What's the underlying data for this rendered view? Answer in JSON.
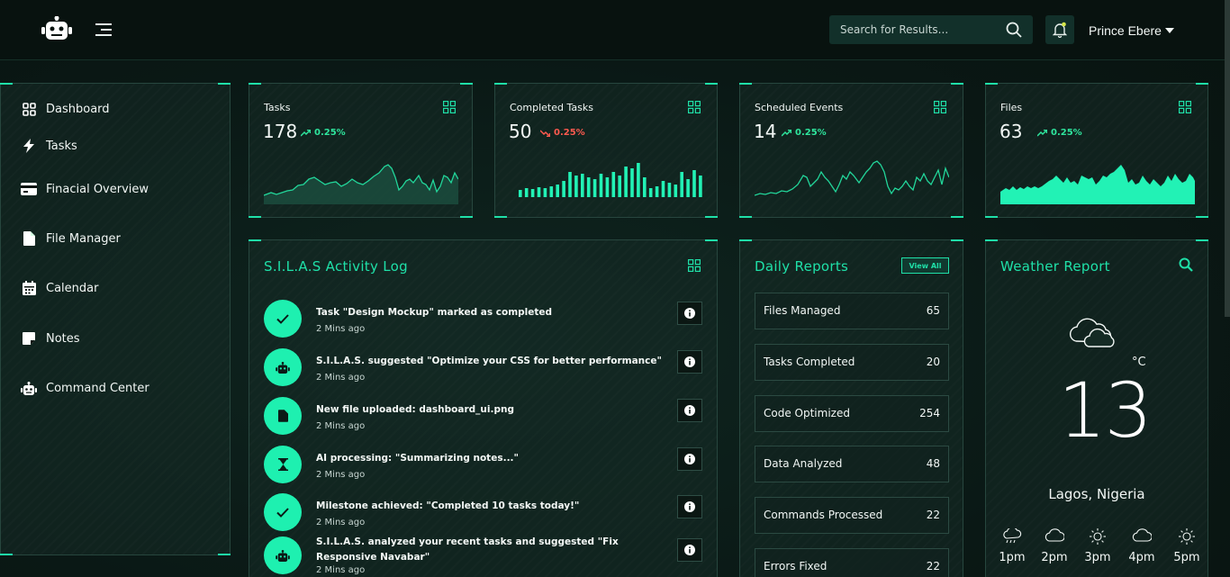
{
  "header": {
    "search_placeholder": "Search for Results...",
    "user_name": "Prince Ebere"
  },
  "sidebar": {
    "items": [
      {
        "label": "Dashboard",
        "icon": "grid-icon"
      },
      {
        "label": "Tasks",
        "icon": "bolt-icon"
      },
      {
        "label": "Finacial Overview",
        "icon": "credit-card-icon"
      },
      {
        "label": "File Manager",
        "icon": "file-icon"
      },
      {
        "label": "Calendar",
        "icon": "calendar-icon"
      },
      {
        "label": "Notes",
        "icon": "note-icon"
      },
      {
        "label": "Command Center",
        "icon": "robot-icon"
      }
    ]
  },
  "stats": [
    {
      "title": "Tasks",
      "value": "178",
      "change": "0.25%",
      "trend": "up",
      "chart": "area"
    },
    {
      "title": "Completed Tasks",
      "value": "50",
      "change": "0.25%",
      "trend": "down",
      "chart": "bar"
    },
    {
      "title": "Scheduled Events",
      "value": "14",
      "change": "0.25%",
      "trend": "up",
      "chart": "line"
    },
    {
      "title": "Files",
      "value": "63",
      "change": "0.25%",
      "trend": "up",
      "chart": "filled-area"
    }
  ],
  "activity": {
    "title": "S.I.L.A.S Activity Log",
    "items": [
      {
        "text": "Task \"Design Mockup\" marked as completed",
        "time": "2 Mins ago",
        "icon": "check-icon"
      },
      {
        "text": "S.I.L.A.S. suggested \"Optimize your CSS for better performance\"",
        "time": "2 Mins ago",
        "icon": "robot-icon"
      },
      {
        "text": "New file uploaded: dashboard_ui.png",
        "time": "2 Mins ago",
        "icon": "file-icon"
      },
      {
        "text": "AI processing: \"Summarizing notes...\"",
        "time": "2 Mins ago",
        "icon": "hourglass-icon"
      },
      {
        "text": "Milestone achieved: \"Completed 10 tasks today!\"",
        "time": "2 Mins ago",
        "icon": "check-icon"
      },
      {
        "text": "S.I.L.A.S. analyzed your recent tasks and suggested \"Fix Responsive Navabar\"",
        "time": "2 Mins ago",
        "icon": "robot-icon"
      }
    ]
  },
  "reports": {
    "title": "Daily Reports",
    "view_all": "View All",
    "items": [
      {
        "label": "Files Managed",
        "value": "65"
      },
      {
        "label": "Tasks Completed",
        "value": "20"
      },
      {
        "label": "Code Optimized",
        "value": "254"
      },
      {
        "label": "Data Analyzed",
        "value": "48"
      },
      {
        "label": "Commands Processed",
        "value": "22"
      },
      {
        "label": "Errors Fixed",
        "value": "22"
      }
    ]
  },
  "weather": {
    "title": "Weather Report",
    "temperature": "13",
    "unit": "°C",
    "location": "Lagos, Nigeria",
    "condition_icon": "cloudy-icon",
    "hourly": [
      {
        "time": "1pm",
        "icon": "rain-cloud-icon"
      },
      {
        "time": "2pm",
        "icon": "cloud-icon"
      },
      {
        "time": "3pm",
        "icon": "sun-icon"
      },
      {
        "time": "4pm",
        "icon": "cloud-icon"
      },
      {
        "time": "5pm",
        "icon": "sun-icon"
      }
    ]
  },
  "colors": {
    "accent": "#1fe0a8",
    "up": "#2ee59d",
    "down": "#ff5a4f",
    "background": "#0b1a16"
  }
}
